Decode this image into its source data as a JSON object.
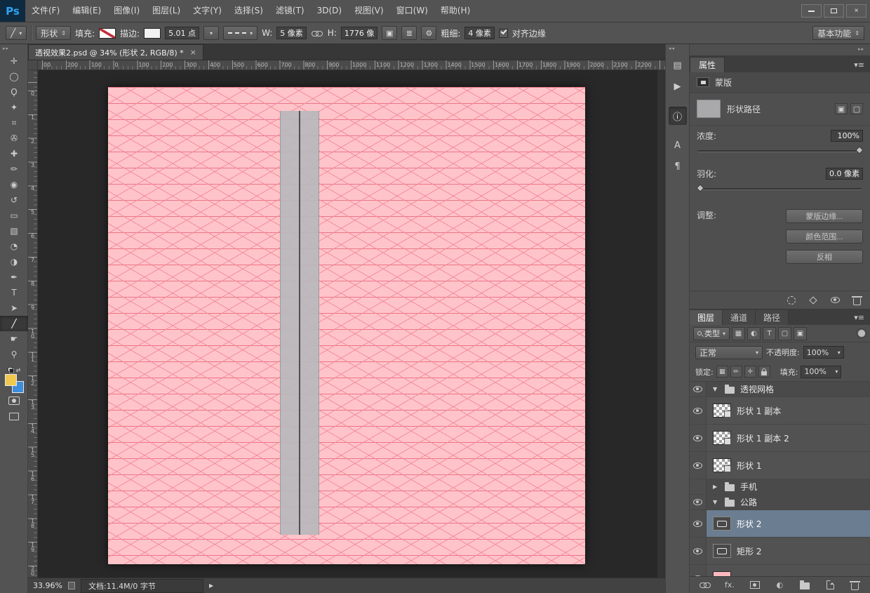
{
  "app": {
    "logo": "Ps"
  },
  "menubar": {
    "items": [
      "文件(F)",
      "编辑(E)",
      "图像(I)",
      "图层(L)",
      "文字(Y)",
      "选择(S)",
      "滤镜(T)",
      "3D(D)",
      "视图(V)",
      "窗口(W)",
      "帮助(H)"
    ]
  },
  "options_bar": {
    "tool_glyph": "╱",
    "mode_value": "形状",
    "fill_label": "填充:",
    "stroke_label": "描边:",
    "stroke_size_value": "5.01 点",
    "w_label": "W:",
    "w_value": "5 像素",
    "h_label": "H:",
    "h_value": "1776 像",
    "weight_label": "粗细:",
    "weight_value": "4 像素",
    "align_edges_label": "对齐边缘",
    "align_edges_checked": true,
    "workspace_value": "基本功能"
  },
  "toolbar": {
    "foreground_color": "#f0c850",
    "background_color": "#3c8ddc",
    "tools": [
      {
        "name": "move-tool",
        "glyph": "✛"
      },
      {
        "name": "marquee-tool",
        "glyph": "◯"
      },
      {
        "name": "lasso-tool",
        "glyph": "Ϙ"
      },
      {
        "name": "quick-selection-tool",
        "glyph": "✦"
      },
      {
        "name": "crop-tool",
        "glyph": "⌗"
      },
      {
        "name": "eyedropper-tool",
        "glyph": "✇"
      },
      {
        "name": "healing-brush-tool",
        "glyph": "✚"
      },
      {
        "name": "brush-tool",
        "glyph": "✏"
      },
      {
        "name": "clone-stamp-tool",
        "glyph": "◉"
      },
      {
        "name": "history-brush-tool",
        "glyph": "↺"
      },
      {
        "name": "eraser-tool",
        "glyph": "▭"
      },
      {
        "name": "gradient-tool",
        "glyph": "▧"
      },
      {
        "name": "blur-tool",
        "glyph": "◔"
      },
      {
        "name": "dodge-tool",
        "glyph": "◑"
      },
      {
        "name": "pen-tool",
        "glyph": "✒"
      },
      {
        "name": "type-tool",
        "glyph": "T"
      },
      {
        "name": "path-selection-tool",
        "glyph": "➤"
      },
      {
        "name": "line-tool",
        "glyph": "╱",
        "selected": true
      },
      {
        "name": "hand-tool",
        "glyph": "☛"
      },
      {
        "name": "zoom-tool",
        "glyph": "⚲"
      }
    ]
  },
  "document": {
    "tab_title": "透视效果2.psd @ 34% (形状 2, RGB/8) *",
    "tab_close": "×",
    "ruler_h_labels": [
      "00",
      "200",
      "100",
      "0",
      "100",
      "200",
      "300",
      "400",
      "500",
      "600",
      "700",
      "800",
      "900",
      "1000",
      "1100",
      "1200",
      "1300",
      "1400",
      "1500",
      "1600",
      "1700",
      "1800",
      "1900",
      "2000",
      "2100",
      "2200"
    ],
    "ruler_v_labels": [
      "0",
      "1",
      "2",
      "3",
      "4",
      "5",
      "6",
      "7",
      "8",
      "9",
      "10",
      "11",
      "12",
      "13",
      "14",
      "15",
      "16",
      "17",
      "18",
      "19",
      "20"
    ],
    "status_zoom": "33.96%",
    "status_doc": "文档:11.4M/0 字节"
  },
  "canvas": {
    "background": "#ffc4c9",
    "grid_line_color": "#f28d9b",
    "grid_line_strong_color": "#ec7487",
    "road_fill": "#b9b9bc",
    "road_line_color": "#45454c"
  },
  "panel_icons": [
    {
      "name": "history-panel-icon",
      "glyph": "▤"
    },
    {
      "name": "actions-panel-icon",
      "glyph": "▶"
    },
    {
      "name": "info-panel-icon",
      "glyph": "ⓘ",
      "pressed": true,
      "gap": true
    },
    {
      "name": "character-panel-icon",
      "glyph": "A",
      "gap": true
    },
    {
      "name": "paragraph-panel-icon",
      "glyph": "¶"
    }
  ],
  "properties": {
    "title": "属性",
    "mask_label": "蒙版",
    "path_label": "形状路径",
    "density_label": "浓度:",
    "density_value": "100%",
    "feather_label": "羽化:",
    "feather_value": "0.0 像素",
    "adjust_label": "调整:",
    "buttons": [
      "蒙版边缘...",
      "颜色范围...",
      "反相"
    ],
    "footer_icons": [
      {
        "name": "load-selection-from-mask-icon",
        "kind": "dashedcircle"
      },
      {
        "name": "apply-mask-icon",
        "kind": "diamond"
      },
      {
        "name": "mask-visibility-eye-icon",
        "kind": "eye"
      },
      {
        "name": "delete-mask-icon",
        "kind": "trash"
      }
    ]
  },
  "layers_panel": {
    "tabs": [
      "图层",
      "通道",
      "路径"
    ],
    "active_tab": 0,
    "filter_label": "类型",
    "filter_icons": [
      {
        "name": "filter-pixel-layers-icon",
        "glyph": "▦"
      },
      {
        "name": "filter-adjustment-layers-icon",
        "glyph": "◐"
      },
      {
        "name": "filter-type-layers-icon",
        "glyph": "T"
      },
      {
        "name": "filter-shape-layers-icon",
        "glyph": "▢"
      },
      {
        "name": "filter-smart-objects-icon",
        "glyph": "▣"
      }
    ],
    "blend_mode": "正常",
    "opacity_label": "不透明度:",
    "opacity_value": "100%",
    "lock_label": "锁定:",
    "lock_icons": [
      {
        "name": "lock-transparency-icon",
        "glyph": "▦"
      },
      {
        "name": "lock-image-icon",
        "glyph": "✏"
      },
      {
        "name": "lock-position-icon",
        "glyph": "✛"
      },
      {
        "name": "lock-all-icon",
        "kind": "lock"
      }
    ],
    "fill_label": "填充:",
    "fill_value": "100%",
    "layers": [
      {
        "type": "group",
        "name": "透视网格",
        "expanded": true,
        "visible": true
      },
      {
        "type": "layer",
        "name": "形状 1 副本",
        "visible": true,
        "thumb": "checker"
      },
      {
        "type": "layer",
        "name": "形状 1 副本 2",
        "visible": true,
        "thumb": "checker"
      },
      {
        "type": "layer",
        "name": "形状 1",
        "visible": true,
        "thumb": "checker"
      },
      {
        "type": "group",
        "name": "手机",
        "expanded": false,
        "visible": false
      },
      {
        "type": "group",
        "name": "公路",
        "expanded": true,
        "visible": true
      },
      {
        "type": "layer",
        "name": "形状 2",
        "visible": true,
        "thumb": "shape",
        "selected": true
      },
      {
        "type": "layer",
        "name": "矩形 2",
        "visible": true,
        "thumb": "shape"
      },
      {
        "type": "layer",
        "name": "",
        "visible": true,
        "thumb": "pink"
      }
    ],
    "footer_icons": [
      {
        "name": "link-layers-icon",
        "kind": "chain"
      },
      {
        "name": "layer-style-icon",
        "kind": "text",
        "glyph": "fx."
      },
      {
        "name": "add-layer-mask-icon",
        "kind": "maskrect"
      },
      {
        "name": "adjustment-layer-icon",
        "kind": "text",
        "glyph": "◐"
      },
      {
        "name": "new-group-icon",
        "kind": "folder"
      },
      {
        "name": "new-layer-icon",
        "kind": "newpage"
      },
      {
        "name": "delete-layer-icon",
        "kind": "trash"
      }
    ]
  },
  "ui_colors": {
    "selected_layer": "#6b7d90"
  }
}
